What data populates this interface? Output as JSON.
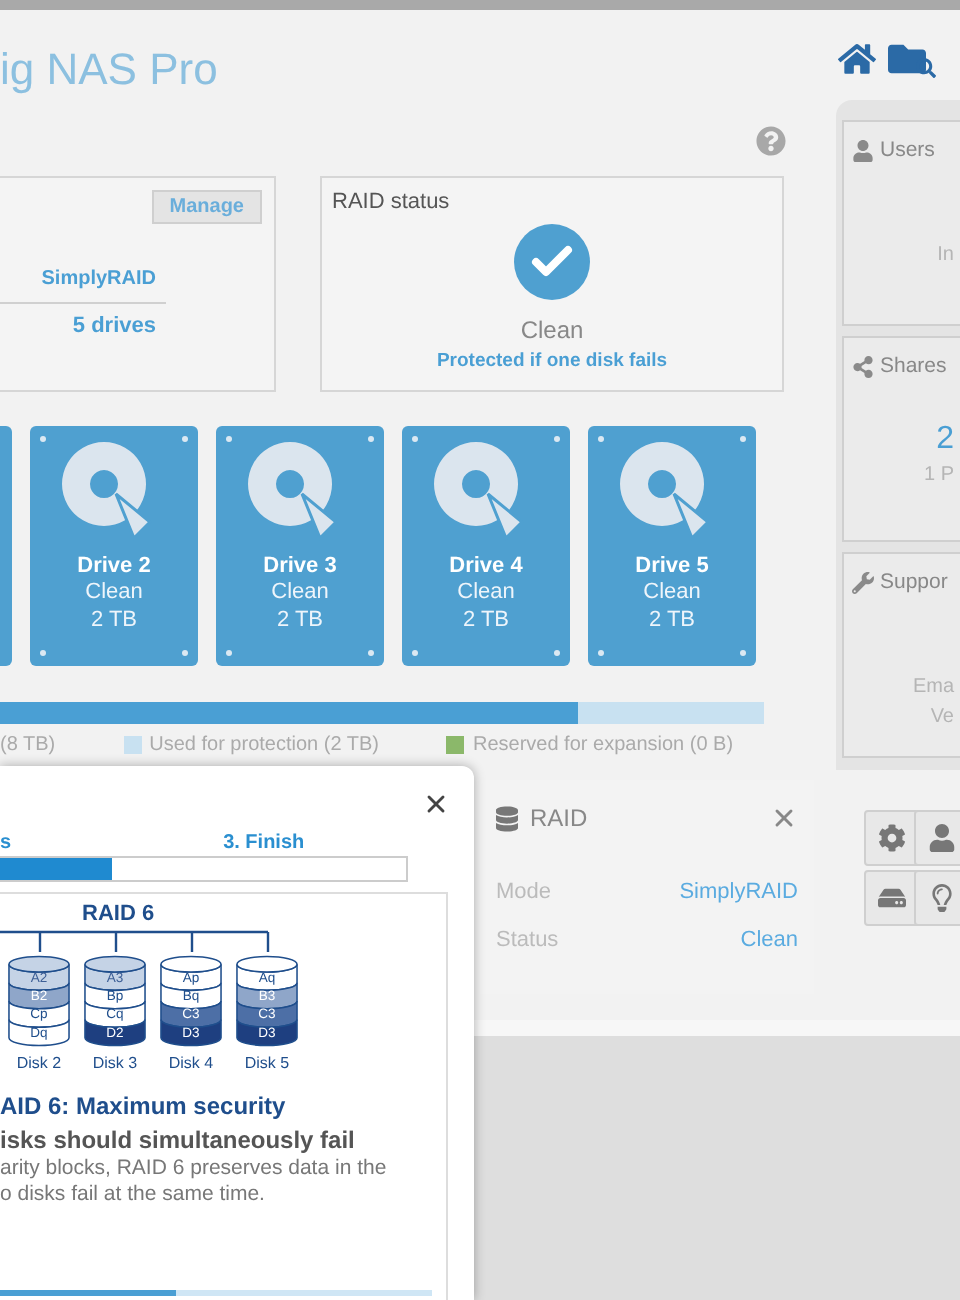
{
  "header": {
    "title": "ig NAS Pro"
  },
  "volume_card": {
    "button": "Manage",
    "mode": "SimplyRAID",
    "drives": "5 drives"
  },
  "raid_status": {
    "title": "RAID status",
    "status": "Clean",
    "note": "Protected if one disk fails"
  },
  "drives": [
    {
      "name": "Drive 2",
      "status": "Clean",
      "size": "2 TB"
    },
    {
      "name": "Drive 3",
      "status": "Clean",
      "size": "2 TB"
    },
    {
      "name": "Drive 4",
      "status": "Clean",
      "size": "2 TB"
    },
    {
      "name": "Drive 5",
      "status": "Clean",
      "size": "2 TB"
    }
  ],
  "capacity": {
    "level": 0.757,
    "legend": [
      {
        "kind": "used",
        "label": "(8 TB)"
      },
      {
        "kind": "protection",
        "label": "Used for protection (2 TB)"
      },
      {
        "kind": "reserved",
        "label": "Reserved for expansion (0 B)"
      }
    ]
  },
  "sidebar": {
    "panels": [
      {
        "kind": "users",
        "title": "Users",
        "lines": [
          "In"
        ]
      },
      {
        "kind": "shares",
        "title": "Shares",
        "value": "2",
        "lines": [
          "1 P"
        ]
      },
      {
        "kind": "support",
        "title": "Suppor",
        "lines": [
          "Ema",
          "Ve"
        ]
      }
    ]
  },
  "wizard": {
    "steps": [
      "s",
      "3. Finish"
    ],
    "progress": {
      "level": 0.276
    },
    "diagram": {
      "title": "RAID 6",
      "disks": [
        {
          "label": "Disk 2",
          "blocks": [
            {
              "text": "A2",
              "kind": "light"
            },
            {
              "text": "B2",
              "kind": "mid"
            },
            {
              "text": "Cp",
              "kind": "blank"
            },
            {
              "text": "Dq",
              "kind": "blank"
            }
          ]
        },
        {
          "label": "Disk 3",
          "blocks": [
            {
              "text": "A3",
              "kind": "light"
            },
            {
              "text": "Bp",
              "kind": "blank"
            },
            {
              "text": "Cq",
              "kind": "blank"
            },
            {
              "text": "D2",
              "kind": "dark"
            }
          ]
        },
        {
          "label": "Disk 4",
          "blocks": [
            {
              "text": "Ap",
              "kind": "blank"
            },
            {
              "text": "Bq",
              "kind": "blank"
            },
            {
              "text": "C3",
              "kind": "strong"
            },
            {
              "text": "D3",
              "kind": "dark"
            }
          ]
        },
        {
          "label": "Disk 5",
          "blocks": [
            {
              "text": "Aq",
              "kind": "blank"
            },
            {
              "text": "B3",
              "kind": "mid"
            },
            {
              "text": "C3",
              "kind": "strong"
            },
            {
              "text": "D3",
              "kind": "dark"
            }
          ]
        }
      ]
    },
    "heading": "AID 6: Maximum security",
    "subheading": "isks should simultaneously fail",
    "description": [
      "arity blocks, RAID 6 preserves data in the",
      "o disks fail at the same time."
    ]
  },
  "raid_panel": {
    "title": "RAID",
    "rows": [
      {
        "label": "Mode",
        "value": "SimplyRAID"
      },
      {
        "label": "Status",
        "value": "Clean"
      }
    ]
  }
}
